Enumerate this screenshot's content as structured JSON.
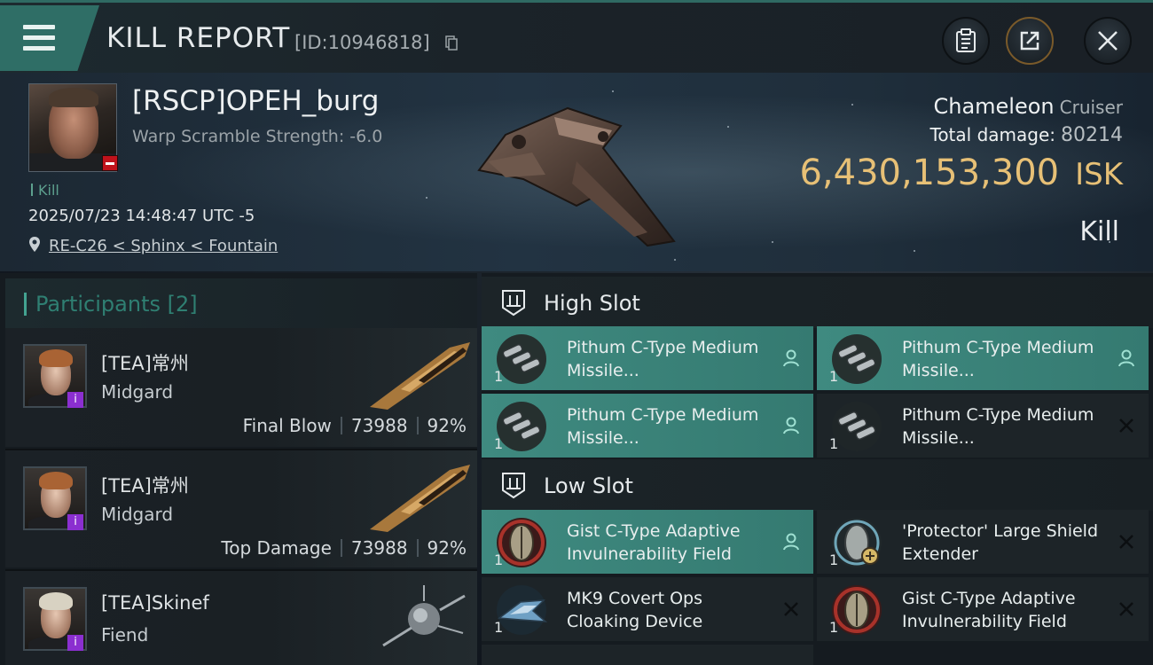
{
  "header": {
    "title": "KILL REPORT",
    "id_text": "[ID:10946818]"
  },
  "victim": {
    "name": "[RSCP]OPEH_burg",
    "warp_scramble": "Warp Scramble Strength: -6.0",
    "tag": "Kill",
    "timestamp": "2025/07/23 14:48:47 UTC -5",
    "location": "RE-C26 < Sphinx < Fountain",
    "ship_name": "Chameleon",
    "ship_class": "Cruiser",
    "total_damage_label": "Total damage:",
    "total_damage": "80214",
    "isk_value": "6,430,153,300",
    "isk_unit": "ISK",
    "result": "Kill"
  },
  "participants": {
    "title": "Participants [2]",
    "rows": [
      {
        "name": "[TEA]常州",
        "corp": "Midgard",
        "role": "Final Blow",
        "damage": "73988",
        "percent": "92%"
      },
      {
        "name": "[TEA]常州",
        "corp": "Midgard",
        "role": "Top Damage",
        "damage": "73988",
        "percent": "92%"
      },
      {
        "name": "[TEA]Skinef",
        "corp": "Fiend",
        "role": "",
        "damage": "",
        "percent": ""
      }
    ]
  },
  "high_slot": {
    "title": "High Slot",
    "items": [
      {
        "name": "Pithum C-Type Medium Missile...",
        "qty": "1",
        "state": "pilot-icon"
      },
      {
        "name": "Pithum C-Type Medium Missile...",
        "qty": "1",
        "state": "pilot-icon"
      },
      {
        "name": "Pithum C-Type Medium Missile...",
        "qty": "1",
        "state": "pilot-icon"
      },
      {
        "name": "Pithum C-Type Medium Missile...",
        "qty": "1",
        "state": "destroyed-icon"
      }
    ]
  },
  "low_slot": {
    "title": "Low Slot",
    "items": [
      {
        "name": "Gist C-Type Adaptive Invulnerability Field",
        "qty": "1",
        "state": "pilot-icon"
      },
      {
        "name": "'Protector' Large Shield Extender",
        "qty": "1",
        "state": "destroyed-icon"
      },
      {
        "name": "MK9 Covert Ops Cloaking Device",
        "qty": "1",
        "state": "destroyed-icon"
      },
      {
        "name": "Gist C-Type Adaptive Invulnerability Field",
        "qty": "1",
        "state": "destroyed-icon"
      }
    ]
  },
  "colors": {
    "accent_teal": "#3f8a80",
    "isk_gold": "#e7c076",
    "destroyed_red": "#c0121b",
    "badge_purple": "#8b2fd0"
  }
}
